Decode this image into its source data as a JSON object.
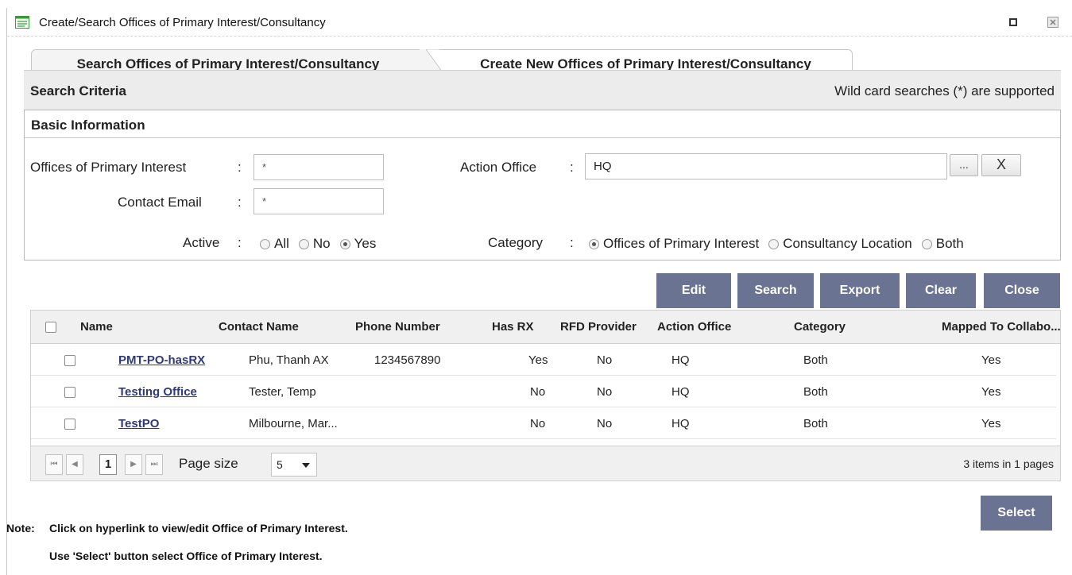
{
  "window": {
    "title": "Create/Search Offices of Primary Interest/Consultancy"
  },
  "tabs": [
    {
      "label": "Search Offices of Primary Interest/Consultancy"
    },
    {
      "label": "Create New Offices of Primary Interest/Consultancy"
    }
  ],
  "criteria": {
    "title": "Search Criteria",
    "hint": "Wild card searches (*) are supported"
  },
  "basic": {
    "title": "Basic Information",
    "opi_label": "Offices of Primary Interest",
    "opi_value": "*",
    "email_label": "Contact Email",
    "email_value": "*",
    "action_label": "Action Office",
    "action_value": "HQ",
    "browse_label": "...",
    "clear_label": "X",
    "active_label": "Active",
    "active_options": [
      "All",
      "No",
      "Yes"
    ],
    "active_selected": "Yes",
    "category_label": "Category",
    "category_options": [
      "Offices of Primary Interest",
      "Consultancy Location",
      "Both"
    ],
    "category_selected": "Offices of Primary Interest",
    "colon": ":"
  },
  "actions": {
    "edit": "Edit",
    "search": "Search",
    "export": "Export",
    "clear": "Clear",
    "close": "Close"
  },
  "grid": {
    "columns": [
      "Name",
      "Contact Name",
      "Phone Number",
      "Has RX",
      "RFD Provider",
      "Action Office",
      "Category",
      "Mapped To Collabo..."
    ],
    "rows": [
      {
        "name": "PMT-PO-hasRX",
        "contact": "Phu, Thanh AX",
        "phone": "1234567890",
        "has_rx": "Yes",
        "rfd": "No",
        "office": "HQ",
        "category": "Both",
        "mapped": "Yes"
      },
      {
        "name": "Testing Office",
        "contact": "Tester, Temp",
        "phone": "",
        "has_rx": "No",
        "rfd": "No",
        "office": "HQ",
        "category": "Both",
        "mapped": "Yes"
      },
      {
        "name": "TestPO",
        "contact": "Milbourne, Mar...",
        "phone": "",
        "has_rx": "No",
        "rfd": "No",
        "office": "HQ",
        "category": "Both",
        "mapped": "Yes"
      }
    ]
  },
  "pager": {
    "page": "1",
    "page_size_label": "Page size",
    "page_size": "5",
    "info": "3 items in 1 pages"
  },
  "select_label": "Select",
  "notes": {
    "prefix": "Note:",
    "line1": "Click on hyperlink to view/edit Office of Primary Interest.",
    "line2": "Use 'Select' button select Office of Primary Interest."
  },
  "colors": {
    "button_bg": "#6b7393",
    "link": "#2f3a7a",
    "header_bg": "#ececec"
  }
}
